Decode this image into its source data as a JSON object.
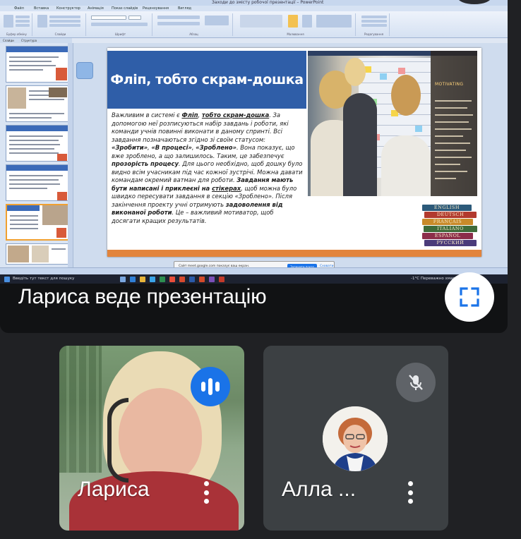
{
  "shared_screen": {
    "window_title": "Заходи до змісту робочої презентації – PowerPoint",
    "ribbon_tabs": [
      "Файл",
      "Вставка",
      "Конструктор",
      "Анімація",
      "Показ слайдів",
      "Рецензування",
      "Вигляд"
    ],
    "ribbon_groups": [
      "Буфер обміну",
      "Слайди",
      "Шрифт",
      "Абзац",
      "Малювання",
      "Редагування"
    ],
    "outline_tabs": [
      "Слайди",
      "Структура"
    ],
    "thumbnail_count": 6,
    "active_thumbnail": 5,
    "slide": {
      "title": "Фліп, тобто скрам-дошка",
      "photo_caption": "MOTIVATING",
      "body": {
        "p1_a": "Важливим в системі є ",
        "p1_bold": "Фліп",
        "p1_b": ", ",
        "p1_bold2": "тобто скрам-дошка",
        "p1_c": ". За допомогою неї розписуються набір завдань і роботи, які команди учнів повинні виконати в даному спринті. Всі завдання позначаються згідно зі своїм статусом: ",
        "status_1": "«Зробити»",
        "sep_1": ", ",
        "status_2": "«В процесі»",
        "sep_2": ", ",
        "status_3": "«Зроблено»",
        "p1_d": ". Вона показує, що вже зроблено, а що залишилось. Таким, це забезпечує ",
        "p1_bold3": "прозорість процесу",
        "p1_e": ". Для цього необхідно, щоб дошку було видно всім учасникам під час кожної зустрічі. Можна давати командам окремий ватман для роботи. ",
        "p2_bold": "Завдання мають бути написані і приклеєні на ",
        "p2_u": "стікерах",
        "p2_a": ", щоб можна було швидко пересувати завдання в секцію «Зроблено». Після закінчення проекту учні отримують ",
        "p2_bold2": "задоволення від виконаної роботи",
        "p2_b": ". Це – важливий мотиватор, щоб досягати кращих результатів."
      },
      "books": [
        "ENGLISH",
        "DEUTSCH",
        "FRANÇAIS",
        "ITALIANO",
        "ESPAÑOL",
        "РУССКИЙ"
      ]
    },
    "share_bar": {
      "text": "Сайт meet.google.com показує ваш екран.",
      "stop": "Зупинити показ",
      "hide": "Сховати"
    },
    "taskbar": {
      "search_text": "Введіть тут текст для пошуку",
      "weather": "-1°C  Переважно хмарно"
    }
  },
  "presenting_label": "Лариса веде презентацію",
  "participants": [
    {
      "name": "Лариса",
      "state": "speaking"
    },
    {
      "name": "Алла ...",
      "state": "muted"
    }
  ],
  "icons": {
    "fullscreen": "fullscreen-icon",
    "more": "more-vert-icon",
    "speaking": "audio-level-icon",
    "muted": "mic-off-icon"
  },
  "colors": {
    "meet_bg": "#202124",
    "tile_bg": "#3c4043",
    "accent_blue": "#1a73e8",
    "slide_title_bg": "#2f5ea8",
    "slide_footer": "#e2843c"
  }
}
